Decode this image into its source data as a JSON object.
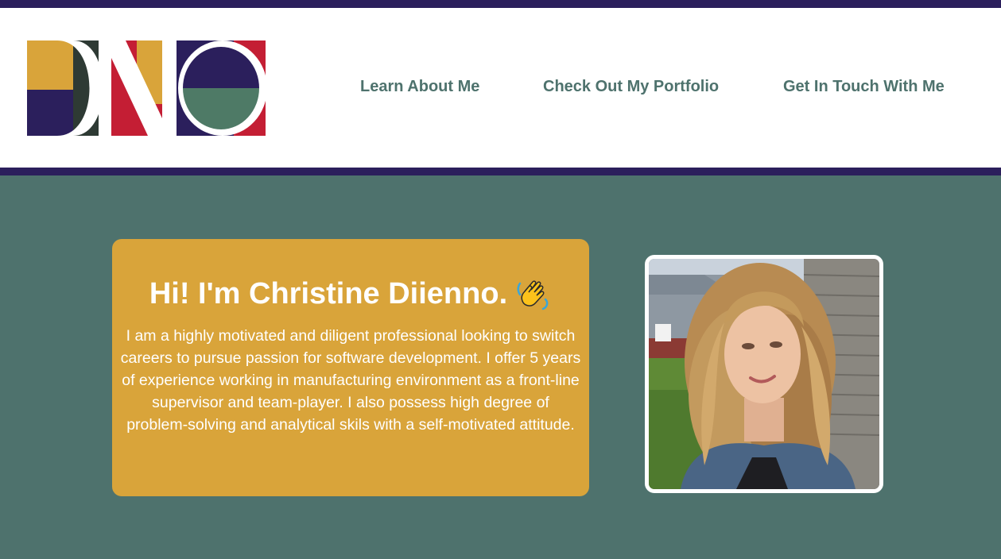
{
  "header": {
    "logo_alt": "DNO",
    "nav": [
      {
        "label": "Learn About Me"
      },
      {
        "label": "Check Out My Portfolio"
      },
      {
        "label": "Get In Touch With Me"
      }
    ]
  },
  "intro": {
    "title": "Hi! I'm Christine Diienno.",
    "title_icon": "waving-hand-icon",
    "body": "I am a highly motivated and diligent professional looking to switch careers to pursue passion for software development. I offer 5 years of experience working in manufacturing environment as a front-line supervisor and team-player. I also possess high degree of problem-solving and analytical skils with a self-motivated attitude."
  },
  "profile_photo": {
    "icon": "profile-photo"
  },
  "colors": {
    "dark_purple": "#2b1f5c",
    "teal": "#4e726d",
    "gold": "#d9a43a",
    "crimson": "#c41e34",
    "dark_green": "#2e3a34",
    "white": "#ffffff"
  }
}
